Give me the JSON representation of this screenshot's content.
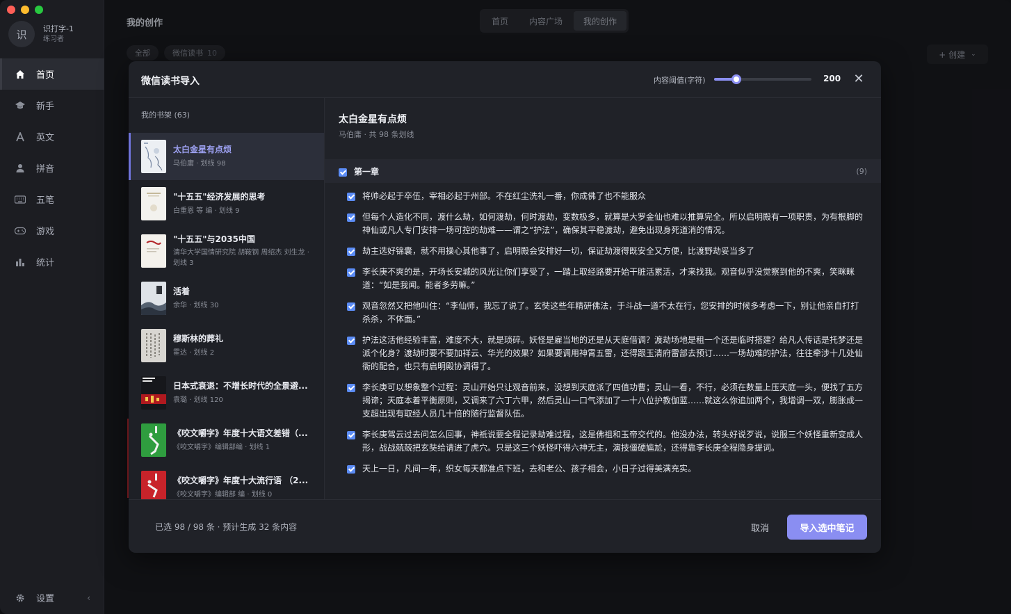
{
  "sidebar": {
    "profile": {
      "avatar": "识",
      "name": "识打字-1",
      "role": "练习者"
    },
    "items": [
      {
        "label": "首页",
        "icon": "home-icon"
      },
      {
        "label": "新手",
        "icon": "graduation-cap-icon"
      },
      {
        "label": "英文",
        "icon": "letter-a-icon"
      },
      {
        "label": "拼音",
        "icon": "user-icon"
      },
      {
        "label": "五笔",
        "icon": "keyboard-icon"
      },
      {
        "label": "游戏",
        "icon": "gamepad-icon"
      },
      {
        "label": "统计",
        "icon": "bar-chart-icon"
      }
    ],
    "settings_label": "设置"
  },
  "header": {
    "page_title": "我的创作",
    "tabs": [
      "首页",
      "内容广场",
      "我的创作"
    ],
    "active_tab": "我的创作"
  },
  "filters": {
    "all": "全部",
    "weread": "微信读书",
    "weread_count": "10"
  },
  "create_label": "+ 创建",
  "modal": {
    "title": "微信读书导入",
    "threshold_label": "内容阈值(字符)",
    "threshold_value": "200",
    "threshold_fraction": 0.23,
    "shelf_title": "我的书架 (63)",
    "books": [
      {
        "title": "太白金星有点烦",
        "meta": "马伯庸 · 划线 98"
      },
      {
        "title": "\"十五五\"经济发展的思考",
        "meta": "白重恩 等 编 · 划线 9"
      },
      {
        "title": "\"十五五\"与2035中国",
        "meta": "清华大学国情研究院 胡鞍钢 周绍杰 刘生龙 · 划线 3"
      },
      {
        "title": "活着",
        "meta": "余华 · 划线 30"
      },
      {
        "title": "穆斯林的葬礼",
        "meta": "霍达 · 划线 2"
      },
      {
        "title": "日本式衰退：不增长时代的全景避...",
        "meta": "袁璐 · 划线 120"
      },
      {
        "title": "《咬文嚼字》年度十大语文差错（...",
        "meta": "《咬文嚼字》编辑部编 · 划线 1"
      },
      {
        "title": "《咬文嚼字》年度十大流行语 （2...",
        "meta": "《咬文嚼字》编辑部 编 · 划线 0"
      }
    ],
    "detail": {
      "title": "太白金星有点烦",
      "meta": "马伯庸 · 共 98 条划线",
      "chapter": "第一章",
      "chapter_count": "(9)",
      "notes": [
        "将帅必起于卒伍，宰相必起于州部。不在红尘洗礼一番，你成佛了也不能服众",
        "但每个人造化不同，渡什么劫，如何渡劫，何时渡劫，变数极多，就算是大罗金仙也难以推算完全。所以启明殿有一项职责，为有根脚的神仙或凡人专门安排一场可控的劫难——谓之“护法”，确保其平稳渡劫，避免出现身死道消的情况。",
        "劫主选好锦囊，就不用操心其他事了，启明殿会安排好一切，保证劫渡得既安全又方便，比渡野劫妥当多了",
        "李长庚不爽的是，开场长安城的风光让你们享受了，一踏上取经路要开始干脏活累活，才来找我。观音似乎没觉察到他的不爽，笑眯眯道：“如是我闻。能者多劳嘛。”",
        "观音忽然又把他叫住：“李仙师，我忘了说了。玄奘这些年精研佛法，于斗战一道不太在行，您安排的时候多考虑一下，别让他亲自打打杀杀，不体面。”",
        "护法这活他经验丰富，难度不大，就是琐碎。妖怪是雇当地的还是从天庭借调？渡劫场地是租一个还是临时搭建？给凡人传话是托梦还是派个化身？渡劫时要不要加祥云、华光的效果？如果要调用神霄五雷，还得跟玉清府雷部去预订……一场劫难的护法，往往牵涉十几处仙衙的配合，也只有启明殿协调得了。",
        "李长庚可以想象整个过程：灵山开始只让观音前来，没想到天庭派了四值功曹；灵山一看，不行，必须在数量上压天庭一头，便找了五方揭谛；天庭本着平衡原则，又调来了六丁六甲，然后灵山一口气添加了一十八位护教伽蓝……就这么你追加两个，我增调一双，膨胀成一支超出现有取经人员几十倍的随行监督队伍。",
        "李长庚驾云过去问怎么回事，神祇说要全程记录劫难过程，这是佛祖和玉帝交代的。他没办法，转头好说歹说，说服三个妖怪重新变成人形，战战兢兢把玄奘给请进了虎穴。只是这三个妖怪吓得六神无主，演技僵硬尴尬，还得靠李长庚全程隐身提词。",
        "天上一日，凡间一年，织女每天都准点下班，去和老公、孩子相会，小日子过得美满充实。"
      ]
    },
    "footer": {
      "summary": "已选 98 / 98 条 · 预计生成 32 条内容",
      "cancel": "取消",
      "import": "导入选中笔记"
    }
  }
}
